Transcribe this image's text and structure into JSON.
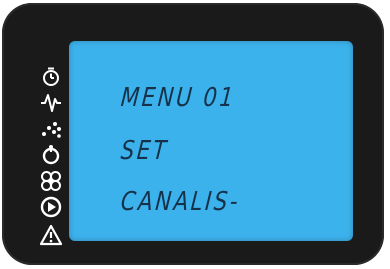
{
  "display": {
    "line1": "MENU 01",
    "line2": "SET",
    "line3": "CANALIS-"
  },
  "colors": {
    "bezel": "#1a1a1a",
    "lcd_background": "#3cb2ec",
    "lcd_text": "#16324a",
    "icon": "#ffffff"
  },
  "icons": [
    "timer-icon",
    "waveform-icon",
    "spray-icon",
    "droplet-icon",
    "fan-icon",
    "play-icon",
    "warning-icon"
  ]
}
